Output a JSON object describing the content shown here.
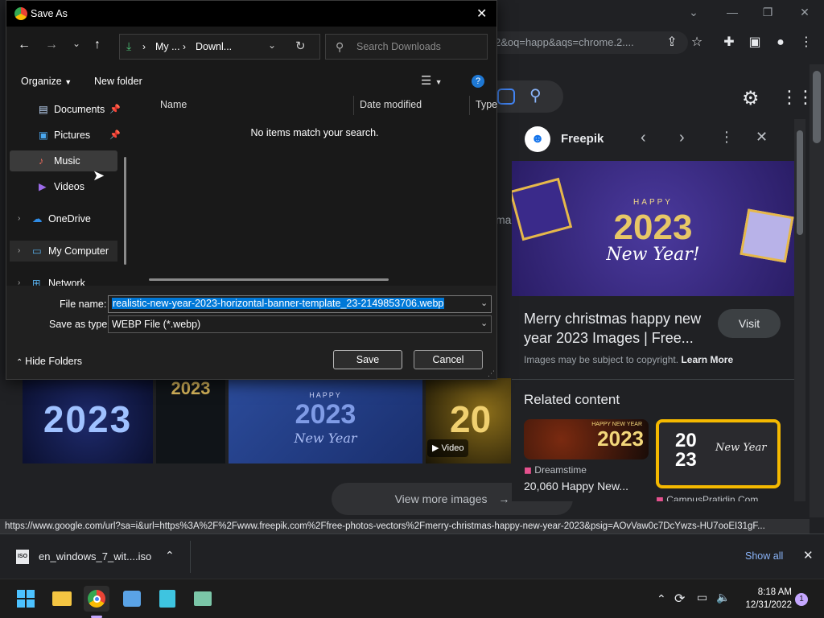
{
  "chrome": {
    "omnibox_text": "2&oq=happ&aqs=chrome.2....",
    "statusbar_url": "https://www.google.com/url?sa=i&url=https%3A%2F%2Fwww.freepik.com%2Ffree-photos-vectors%2Fmerry-christmas-happy-new-year-2023&psig=AOvVaw0c7DcYwzs-HU7ooEI31gF..."
  },
  "side_panel": {
    "site_name": "Freepik",
    "banner_text": {
      "happy": "HAPPY",
      "year": "2023",
      "new_year": "New Year!"
    },
    "result_title": "Merry christmas happy new year 2023 Images | Free...",
    "visit_label": "Visit",
    "copyright_note": "Images may be subject to copyright.",
    "learn_more": "Learn More",
    "related_heading": "Related content",
    "related": [
      {
        "source": "Dreamstime",
        "title": "20,060 Happy New...",
        "thumb_text": "2023",
        "thumb_small": "HAPPY NEW YEAR"
      },
      {
        "source": "CampusPratidin.Com",
        "title": "",
        "thumb_top": "20",
        "thumb_bottom": "23",
        "thumb_script": "New Year"
      }
    ]
  },
  "page": {
    "view_more_label": "View more images",
    "thumbs": [
      {
        "text": "2023"
      },
      {
        "text": "2023"
      },
      {
        "happy": "HAPPY",
        "year": "2023",
        "script": "New Year"
      },
      {
        "text": "20",
        "badge": "Video"
      }
    ]
  },
  "dialog": {
    "title": "Save As",
    "path_parts": [
      "My ...",
      "Downl..."
    ],
    "search_placeholder": "Search Downloads",
    "organize_label": "Organize",
    "new_folder_label": "New folder",
    "nav_items": [
      {
        "label": "Documents",
        "pinned": true,
        "icon": "documents-icon"
      },
      {
        "label": "Pictures",
        "pinned": true,
        "icon": "pictures-icon"
      },
      {
        "label": "Music",
        "pinned": false,
        "icon": "music-icon"
      },
      {
        "label": "Videos",
        "pinned": false,
        "icon": "videos-icon"
      },
      {
        "label": "OneDrive",
        "pinned": false,
        "icon": "onedrive-icon"
      },
      {
        "label": "My Computer",
        "pinned": false,
        "icon": "computer-icon"
      },
      {
        "label": "Network",
        "pinned": false,
        "icon": "network-icon"
      }
    ],
    "columns": [
      "Name",
      "Date modified",
      "Type"
    ],
    "empty_message": "No items match your search.",
    "file_name_label": "File name:",
    "file_name_value": "realistic-new-year-2023-horizontal-banner-template_23-2149853706.webp",
    "save_as_type_label": "Save as type:",
    "save_as_type_value": "WEBP File (*.webp)",
    "hide_folders_label": "Hide Folders",
    "save_label": "Save",
    "cancel_label": "Cancel"
  },
  "downloads": {
    "item_name": "en_windows_7_wit....iso",
    "show_all_label": "Show all"
  },
  "taskbar": {
    "time": "8:18 AM",
    "date": "12/31/2022",
    "notification_count": "1"
  }
}
